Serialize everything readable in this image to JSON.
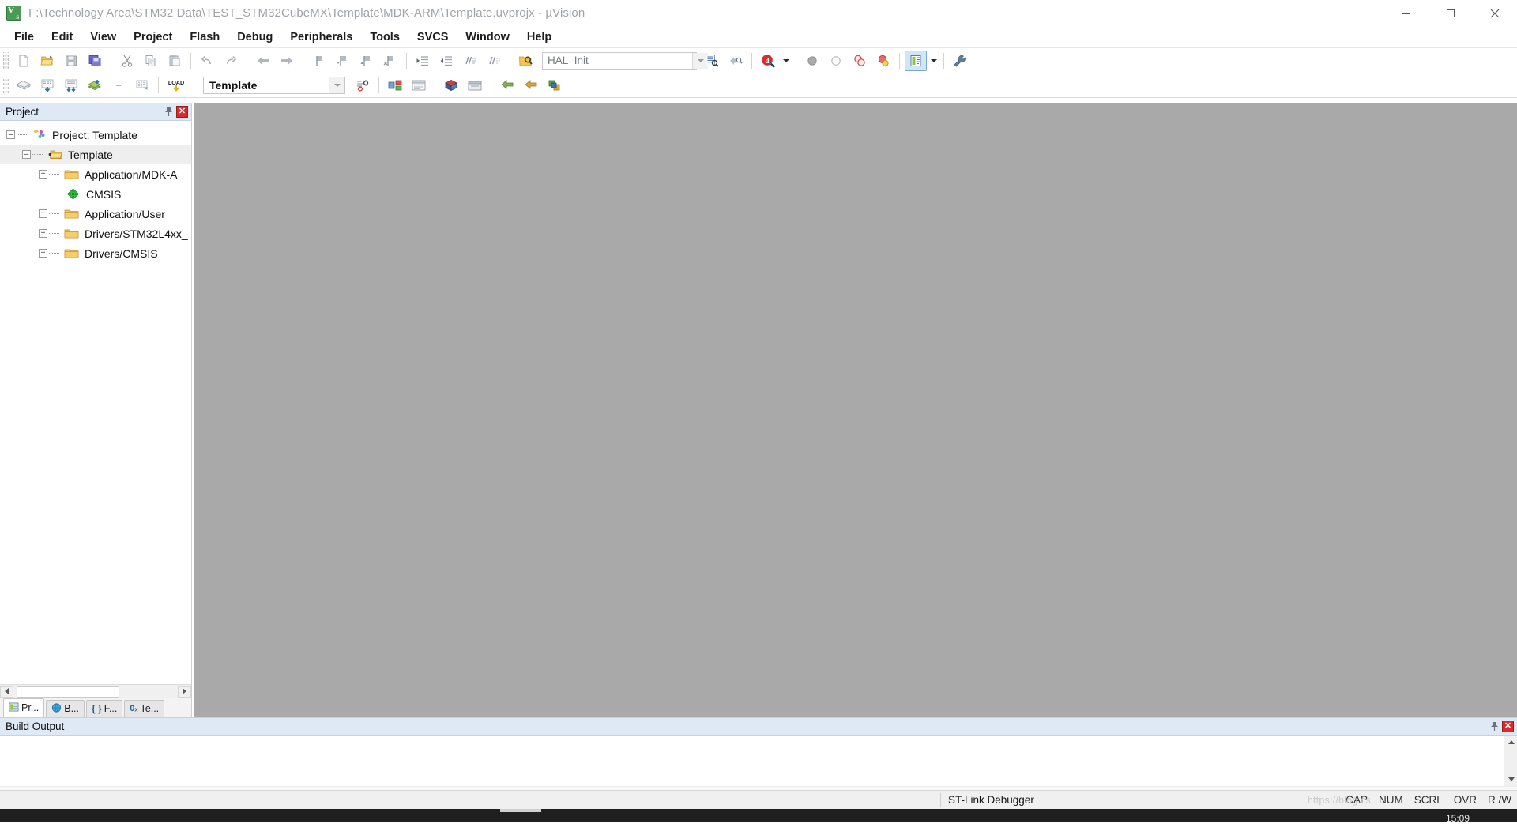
{
  "window": {
    "title": "F:\\Technology Area\\STM32 Data\\TEST_STM32CubeMX\\Template\\MDK-ARM\\Template.uvprojx - µVision",
    "app_icon": "uvision-logo-icon",
    "minimize_label": "Minimize",
    "maximize_label": "Maximize",
    "close_label": "Close"
  },
  "menubar": {
    "items": [
      {
        "label": "File",
        "name": "menu-file"
      },
      {
        "label": "Edit",
        "name": "menu-edit"
      },
      {
        "label": "View",
        "name": "menu-view"
      },
      {
        "label": "Project",
        "name": "menu-project"
      },
      {
        "label": "Flash",
        "name": "menu-flash"
      },
      {
        "label": "Debug",
        "name": "menu-debug"
      },
      {
        "label": "Peripherals",
        "name": "menu-peripherals"
      },
      {
        "label": "Tools",
        "name": "menu-tools"
      },
      {
        "label": "SVCS",
        "name": "menu-svcs"
      },
      {
        "label": "Window",
        "name": "menu-window"
      },
      {
        "label": "Help",
        "name": "menu-help"
      }
    ]
  },
  "toolbar_main": {
    "buttons": [
      {
        "name": "new-file-icon",
        "title": "New"
      },
      {
        "name": "open-file-icon",
        "title": "Open"
      },
      {
        "name": "save-icon",
        "title": "Save"
      },
      {
        "name": "save-all-icon",
        "title": "Save All"
      },
      {
        "name": "cut-icon",
        "title": "Cut"
      },
      {
        "name": "copy-icon",
        "title": "Copy"
      },
      {
        "name": "paste-icon",
        "title": "Paste"
      },
      {
        "name": "undo-icon",
        "title": "Undo"
      },
      {
        "name": "redo-icon",
        "title": "Redo"
      },
      {
        "name": "navigate-back-icon",
        "title": "Back"
      },
      {
        "name": "navigate-forward-icon",
        "title": "Forward"
      },
      {
        "name": "bookmark-toggle-icon",
        "title": "Insert/Remove Bookmark"
      },
      {
        "name": "bookmark-prev-icon",
        "title": "Previous Bookmark"
      },
      {
        "name": "bookmark-next-icon",
        "title": "Next Bookmark"
      },
      {
        "name": "bookmark-clear-icon",
        "title": "Clear All Bookmarks"
      },
      {
        "name": "indent-right-icon",
        "title": "Indent Selected Text"
      },
      {
        "name": "indent-left-icon",
        "title": "Unindent Selected Text"
      },
      {
        "name": "comment-lines-icon",
        "title": "Comment Selection"
      },
      {
        "name": "uncomment-lines-icon",
        "title": "Uncomment Selection"
      },
      {
        "name": "find-in-files-icon",
        "title": "Find in Files"
      }
    ],
    "search_value": "HAL_Init",
    "search_placeholder": "",
    "after_search": [
      {
        "name": "text-lookup-icon",
        "title": "Find"
      },
      {
        "name": "incremental-find-icon",
        "title": "Incremental Find"
      },
      {
        "name": "debug-start-icon",
        "title": "Start/Stop Debug Session"
      }
    ],
    "breakpoint_buttons": [
      {
        "name": "breakpoint-insert-icon",
        "title": "Insert/Remove Breakpoint"
      },
      {
        "name": "breakpoint-enable-icon",
        "title": "Enable/Disable Breakpoint"
      },
      {
        "name": "breakpoint-disable-all-icon",
        "title": "Disable All Breakpoints"
      },
      {
        "name": "breakpoint-kill-all-icon",
        "title": "Kill All Breakpoints"
      }
    ],
    "window_buttons": [
      {
        "name": "manage-windows-icon",
        "title": "Manage Project Windows"
      },
      {
        "name": "configuration-wizard-icon",
        "title": "Configure"
      }
    ]
  },
  "toolbar_build": {
    "buttons": [
      {
        "name": "translate-file-icon",
        "title": "Translate Current File"
      },
      {
        "name": "build-target-icon",
        "title": "Build"
      },
      {
        "name": "rebuild-all-icon",
        "title": "Rebuild All Target Files"
      },
      {
        "name": "batch-build-icon",
        "title": "Batch Build"
      },
      {
        "name": "stop-build-icon",
        "title": "Stop Build"
      },
      {
        "name": "download-icon",
        "title": "Download"
      },
      {
        "name": "load-flash-icon",
        "title": "Load Flash"
      }
    ],
    "target_value": "Template",
    "right_buttons": [
      {
        "name": "target-options-icon",
        "title": "Options for Target"
      },
      {
        "name": "manage-run-time-env-icon",
        "title": "Manage Run-Time Environment"
      },
      {
        "name": "manage-project-items-icon",
        "title": "Manage Project Items"
      },
      {
        "name": "select-software-packs-icon",
        "title": "Select Software Packs"
      },
      {
        "name": "pack-installer-icon",
        "title": "Pack Installer"
      }
    ]
  },
  "project_panel": {
    "title": "Project",
    "pin_icon": "pin-icon",
    "close_icon": "close-icon",
    "tree": [
      {
        "label": "Project: Template",
        "icon": "project-icon",
        "depth": 0,
        "expander": "-",
        "selected": false,
        "name": "tree-node-project-template"
      },
      {
        "label": "Template",
        "icon": "target-icon",
        "depth": 1,
        "expander": "-",
        "selected": true,
        "name": "tree-node-template-target"
      },
      {
        "label": "Application/MDK-A",
        "icon": "folder-icon",
        "depth": 2,
        "expander": "+",
        "selected": false,
        "name": "tree-node-application-mdk-arm"
      },
      {
        "label": "CMSIS",
        "icon": "component-icon",
        "depth": 2,
        "expander": "",
        "selected": false,
        "name": "tree-node-cmsis"
      },
      {
        "label": "Application/User",
        "icon": "folder-icon",
        "depth": 2,
        "expander": "+",
        "selected": false,
        "name": "tree-node-application-user"
      },
      {
        "label": "Drivers/STM32L4xx_",
        "icon": "folder-icon",
        "depth": 2,
        "expander": "+",
        "selected": false,
        "name": "tree-node-drivers-stm32l4xx"
      },
      {
        "label": "Drivers/CMSIS",
        "icon": "folder-icon",
        "depth": 2,
        "expander": "+",
        "selected": false,
        "name": "tree-node-drivers-cmsis"
      }
    ],
    "tabs": [
      {
        "label": "Pr...",
        "icon": "project-tab-icon",
        "active": true,
        "name": "panel-tab-project"
      },
      {
        "label": "B...",
        "icon": "books-tab-icon",
        "active": false,
        "name": "panel-tab-books"
      },
      {
        "label": "F...",
        "icon": "functions-tab-icon",
        "active": false,
        "name": "panel-tab-functions"
      },
      {
        "label": "Te...",
        "icon": "templates-tab-icon",
        "active": false,
        "name": "panel-tab-templates"
      }
    ],
    "tab_icon_glyphs": [
      "",
      "",
      "{ }",
      "0ₓ"
    ]
  },
  "build_output": {
    "title": "Build Output",
    "content": "",
    "pin_icon": "pin-icon",
    "close_icon": "close-icon"
  },
  "statusbar": {
    "left_text": "",
    "debugger": "ST-Link Debugger",
    "flags": [
      "CAP",
      "NUM",
      "SCRL",
      "OVR",
      "R /W"
    ]
  },
  "watermark": "https://blog.cs",
  "taskbar": {
    "clock": "15:09"
  },
  "colors": {
    "panel_header": "#dfe9f5",
    "editor_bg": "#a9a9a9",
    "accent": "#cfe6f8",
    "close_red": "#d92b2b",
    "folder": "#f2c14e",
    "cmsis_green": "#2fbf3f"
  }
}
